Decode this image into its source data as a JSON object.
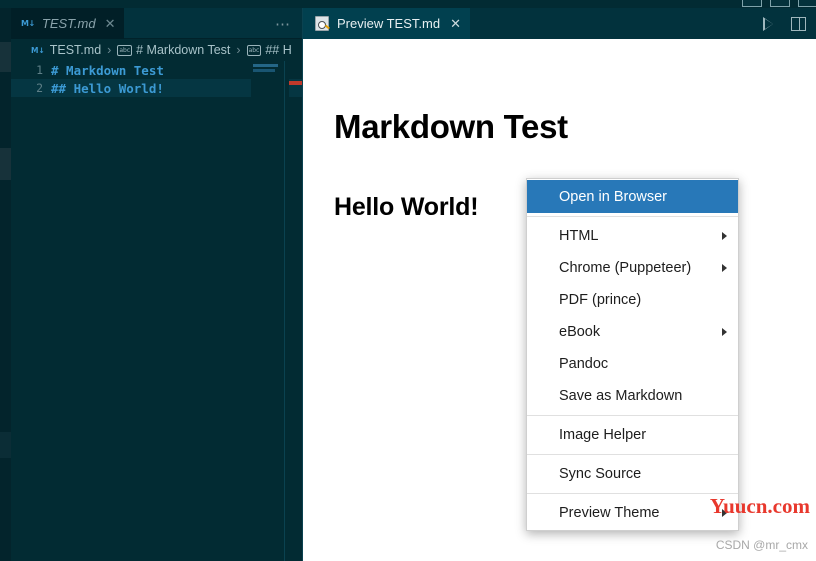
{
  "window": {
    "controls": [
      "minimize-button",
      "maximize-button",
      "close-button"
    ]
  },
  "editor_group": {
    "tab": {
      "icon": "markdown-file-icon",
      "icon_label": "M↓",
      "label": "TEST.md",
      "close_label": "✕"
    },
    "more_actions_label": "⋯",
    "breadcrumb": {
      "file_icon_label": "M↓",
      "file": "TEST.md",
      "separator": "›",
      "symbol_icon_label": "abc",
      "crumb2": "# Markdown Test",
      "crumb3": "## H"
    },
    "lines": [
      {
        "number": "1",
        "text": "# Markdown Test",
        "current": false
      },
      {
        "number": "2",
        "text": "## Hello World!",
        "current": true
      }
    ]
  },
  "preview_group": {
    "tab": {
      "icon": "preview-magnifier-icon",
      "label": "Preview TEST.md",
      "close_label": "✕"
    },
    "actions": [
      {
        "name": "run-icon",
        "label": "Run"
      },
      {
        "name": "split-editor-icon",
        "label": "Split Editor"
      }
    ],
    "content": {
      "heading1": "Markdown Test",
      "heading2": "Hello World!"
    }
  },
  "context_menu": {
    "items": [
      {
        "label": "Open in Browser",
        "selected": true,
        "submenu": false,
        "separator_after": true
      },
      {
        "label": "HTML",
        "selected": false,
        "submenu": true,
        "separator_after": false
      },
      {
        "label": "Chrome (Puppeteer)",
        "selected": false,
        "submenu": true,
        "separator_after": false
      },
      {
        "label": "PDF (prince)",
        "selected": false,
        "submenu": false,
        "separator_after": false
      },
      {
        "label": "eBook",
        "selected": false,
        "submenu": true,
        "separator_after": false
      },
      {
        "label": "Pandoc",
        "selected": false,
        "submenu": false,
        "separator_after": false
      },
      {
        "label": "Save as Markdown",
        "selected": false,
        "submenu": false,
        "separator_after": true
      },
      {
        "label": "Image Helper",
        "selected": false,
        "submenu": false,
        "separator_after": true
      },
      {
        "label": "Sync Source",
        "selected": false,
        "submenu": false,
        "separator_after": true
      },
      {
        "label": "Preview Theme",
        "selected": false,
        "submenu": true,
        "separator_after": false
      }
    ]
  },
  "watermarks": {
    "primary": "Yuucn.com",
    "secondary": "CSDN @mr_cmx"
  },
  "colors": {
    "editor_bg": "#022b33",
    "tabbar_bg": "#02323d",
    "active_tab_bg": "#01404f",
    "accent_blue": "#3c9ad4",
    "menu_selected": "#2878b8",
    "overview_mark": "#c0392b",
    "watermark_red": "#e8382d"
  }
}
